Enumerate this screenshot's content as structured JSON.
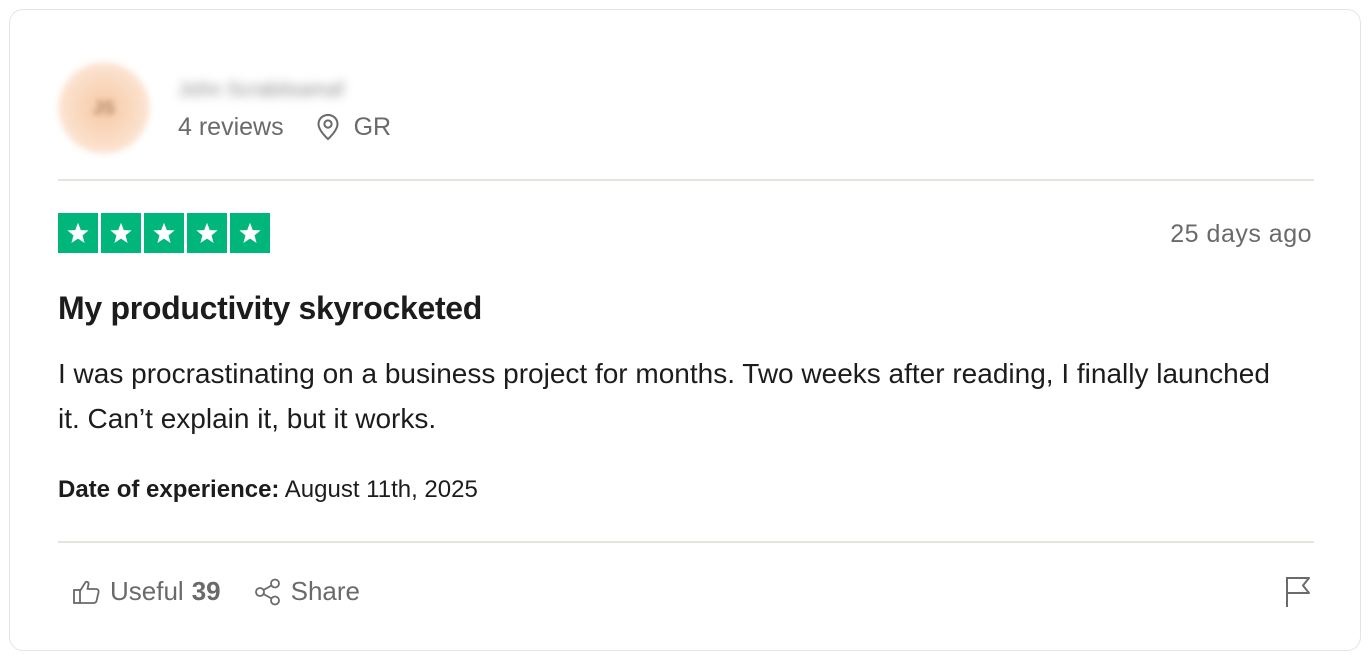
{
  "reviewer": {
    "name": "John Scrabitsamaf",
    "initials": "JS",
    "reviews_count_label": "4 reviews",
    "country": "GR"
  },
  "review": {
    "rating": 5,
    "date_label": "25 days ago",
    "title": "My productivity skyrocketed",
    "body": "I was procrastinating on a business project for months. Two weeks after reading, I finally launched it. Can’t explain it, but it works.",
    "experience_label": "Date of experience:",
    "experience_date": "August 11th, 2025"
  },
  "actions": {
    "useful_label": "Useful",
    "useful_count": "39",
    "share_label": "Share"
  },
  "colors": {
    "star_green": "#00b67a",
    "muted_text": "#696a6a",
    "divider": "#e5e5dd"
  },
  "icons": [
    "location-pin-icon",
    "star-icon",
    "thumbs-up-icon",
    "share-icon",
    "flag-icon"
  ]
}
